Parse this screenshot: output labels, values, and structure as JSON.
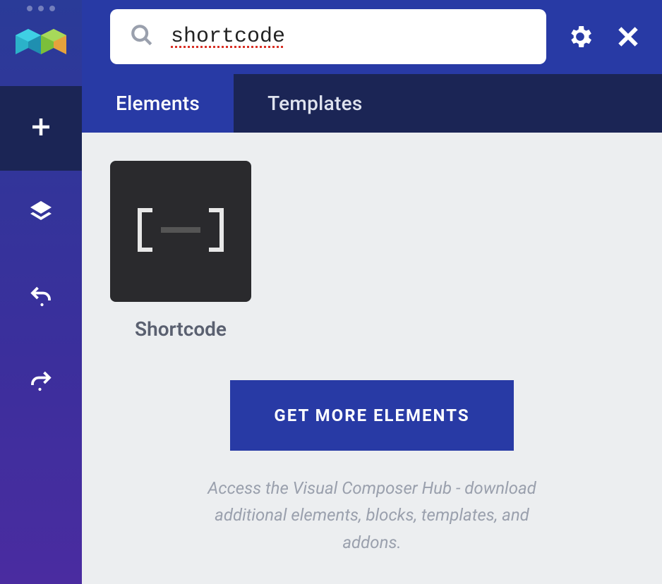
{
  "sidebar": {
    "items": [
      {
        "name": "add",
        "active": true
      },
      {
        "name": "layers",
        "active": false
      },
      {
        "name": "undo",
        "active": false
      },
      {
        "name": "redo",
        "active": false
      }
    ]
  },
  "header": {
    "search_value": "shortcode",
    "search_placeholder": ""
  },
  "tabs": [
    {
      "label": "Elements",
      "active": true
    },
    {
      "label": "Templates",
      "active": false
    }
  ],
  "elements": [
    {
      "label": "Shortcode",
      "icon": "shortcode"
    }
  ],
  "hub": {
    "button_label": "GET MORE ELEMENTS",
    "description": "Access the Visual Composer Hub - download additional elements, blocks, templates, and addons."
  }
}
